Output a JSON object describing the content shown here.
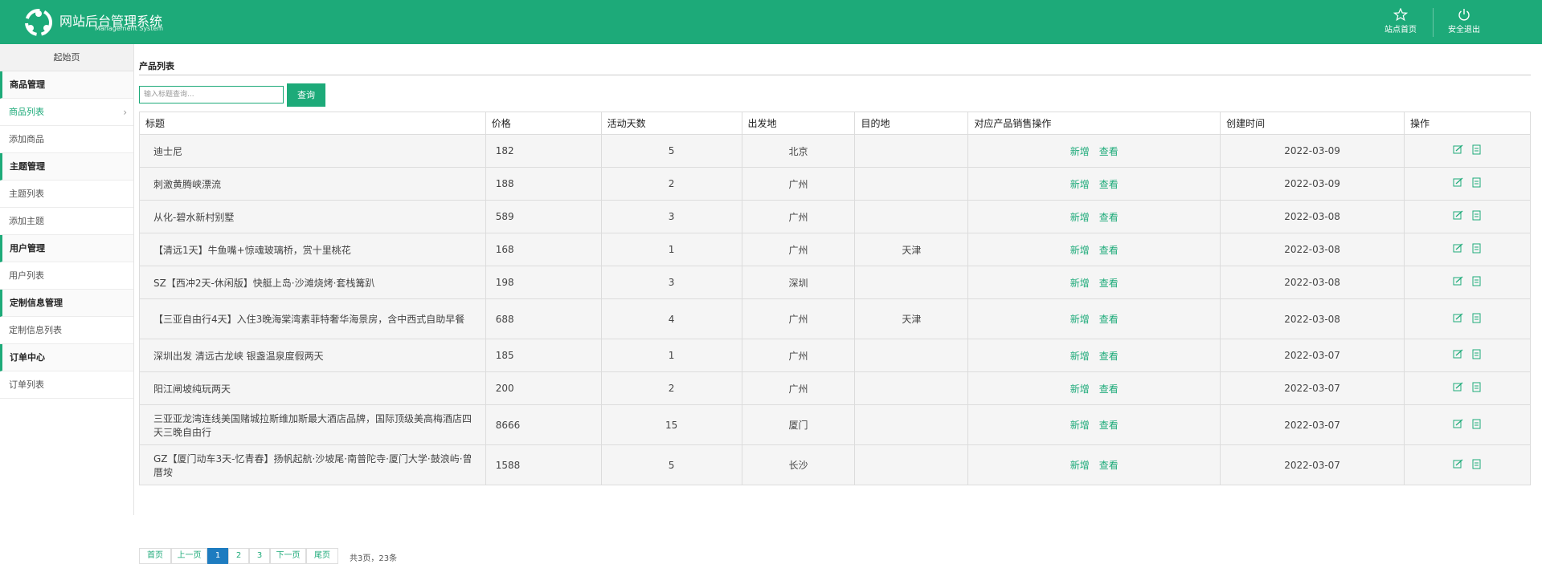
{
  "header": {
    "title": "网站后台管理系统",
    "subtitle": "Management System",
    "site_home_label": "站点首页",
    "logout_label": "安全退出",
    "bg_color": "#1daa79"
  },
  "sidebar": {
    "home_label": "起始页",
    "groups": [
      {
        "title": "商品管理",
        "items": [
          {
            "label": "商品列表"
          },
          {
            "label": "添加商品"
          }
        ]
      },
      {
        "title": "主题管理",
        "items": [
          {
            "label": "主题列表"
          },
          {
            "label": "添加主题"
          }
        ]
      },
      {
        "title": "用户管理",
        "items": [
          {
            "label": "用户列表"
          }
        ]
      },
      {
        "title": "定制信息管理",
        "items": [
          {
            "label": "定制信息列表"
          }
        ]
      },
      {
        "title": "订单中心",
        "items": [
          {
            "label": "订单列表"
          }
        ]
      }
    ]
  },
  "main": {
    "page_title": "产品列表",
    "search": {
      "placeholder": "输入标题查询...",
      "button_label": "查询"
    },
    "table": {
      "columns": [
        "标题",
        "价格",
        "活动天数",
        "出发地",
        "目的地",
        "对应产品销售操作",
        "创建时间",
        "操作"
      ],
      "row_action_add": "新增",
      "row_action_view": "查看",
      "rows": [
        {
          "title": "迪士尼",
          "price": "182",
          "days": "5",
          "from": "北京",
          "to": "",
          "created": "2022-03-09"
        },
        {
          "title": "刺激黄腾峡漂流",
          "price": "188",
          "days": "2",
          "from": "广州",
          "to": "",
          "created": "2022-03-09"
        },
        {
          "title": "从化-碧水新村别墅",
          "price": "589",
          "days": "3",
          "from": "广州",
          "to": "",
          "created": "2022-03-08"
        },
        {
          "title": "【清远1天】牛鱼嘴+惊魂玻璃桥，赏十里桃花",
          "price": "168",
          "days": "1",
          "from": "广州",
          "to": "天津",
          "created": "2022-03-08"
        },
        {
          "title": "SZ【西冲2天-休闲版】快艇上岛·沙滩烧烤·套栈篝趴",
          "price": "198",
          "days": "3",
          "from": "深圳",
          "to": "",
          "created": "2022-03-08"
        },
        {
          "title": "【三亚自由行4天】入住3晚海棠湾素菲特奢华海景房，含中西式自助早餐",
          "price": "688",
          "days": "4",
          "from": "广州",
          "to": "天津",
          "created": "2022-03-08"
        },
        {
          "title": "深圳出发 清远古龙峡 银盏温泉度假两天",
          "price": "185",
          "days": "1",
          "from": "广州",
          "to": "",
          "created": "2022-03-07"
        },
        {
          "title": "阳江闸坡纯玩两天",
          "price": "200",
          "days": "2",
          "from": "广州",
          "to": "",
          "created": "2022-03-07"
        },
        {
          "title": "三亚亚龙湾连线美国赌城拉斯维加斯最大酒店品牌，国际顶级美高梅酒店四天三晚自由行",
          "price": "8666",
          "days": "15",
          "from": "厦门",
          "to": "",
          "created": "2022-03-07"
        },
        {
          "title": "GZ【厦门动车3天-忆青春】扬帆起航·沙坡尾·南普陀寺·厦门大学·鼓浪屿·曾厝垵",
          "price": "1588",
          "days": "5",
          "from": "长沙",
          "to": "",
          "created": "2022-03-07"
        }
      ]
    },
    "pagination": {
      "first": "首页",
      "prev": "上一页",
      "pages": [
        "1",
        "2",
        "3"
      ],
      "current": "1",
      "next": "下一页",
      "last": "尾页",
      "info": "共3页，23条"
    }
  }
}
